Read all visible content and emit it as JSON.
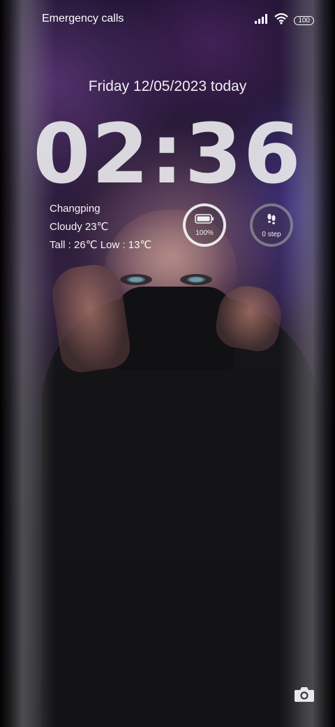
{
  "status_bar": {
    "carrier": "Emergency calls only",
    "battery_level": "100",
    "signal_icon": "signal-bars-icon",
    "wifi_icon": "wifi-icon"
  },
  "lockscreen": {
    "date": "Friday 12/05/2023 today",
    "time": "02:36"
  },
  "weather": {
    "city": "Changping",
    "condition": "Cloudy 23℃",
    "range": "Tall : 26℃  Low : 13℃"
  },
  "widgets": {
    "battery": {
      "label": "100%",
      "icon": "battery-icon",
      "level": 1.0
    },
    "steps": {
      "label": "0 step",
      "icon": "footsteps-icon",
      "count": 0
    }
  },
  "shortcuts": {
    "camera_icon": "camera-icon"
  }
}
